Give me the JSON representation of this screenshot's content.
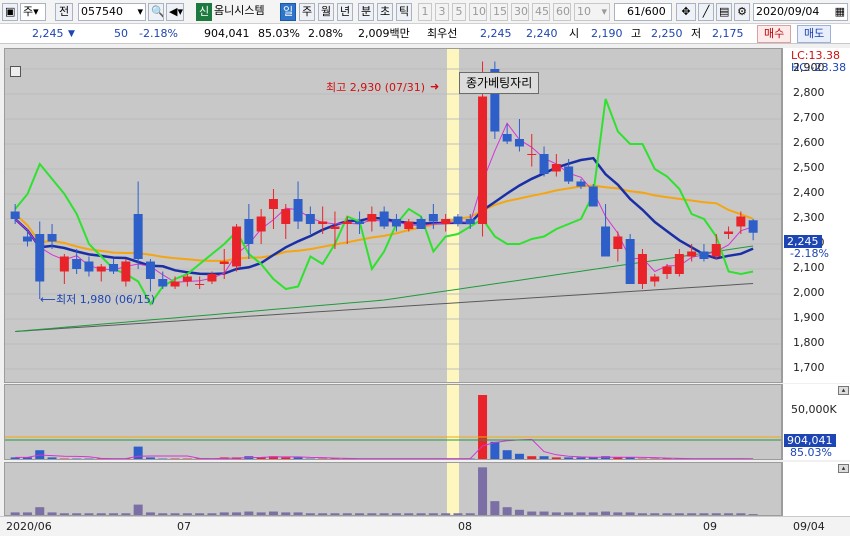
{
  "toolbar": {
    "market_select": "주",
    "prev_btn": "전",
    "code": "057540",
    "speaker_icon": "speaker-icon",
    "sin_badge": "신",
    "company": "옴니시스템",
    "periods": [
      "일",
      "주",
      "월",
      "년",
      "분",
      "초",
      "틱"
    ],
    "active_period": "일",
    "intervals": [
      "1",
      "3",
      "5",
      "10",
      "15",
      "30",
      "45",
      "60"
    ],
    "interval_value": "10",
    "count_value": "61",
    "count_total": "/600",
    "date": "2020/09/04"
  },
  "quote": {
    "price": "2,245",
    "change_arrow": "▼",
    "change": "50",
    "change_pct": "-2.18%",
    "volume": "904,041",
    "vol_ratio": "85.03%",
    "turnover_pct": "2.08%",
    "amount": "2,009백만",
    "best_offer_label": "최우선",
    "best_ask": "2,245",
    "best_bid": "2,240",
    "open_label": "시",
    "open": "2,190",
    "high_label": "고",
    "high": "2,250",
    "low_label": "저",
    "low": "2,175",
    "buy_btn": "매수",
    "sell_btn": "매도"
  },
  "price_axis": {
    "lc": "LC:13.38",
    "hc": "HC:-23.38",
    "ticks": [
      "2,900",
      "2,800",
      "2,700",
      "2,600",
      "2,500",
      "2,400",
      "2,300",
      "2,200",
      "2,100",
      "2,000",
      "1,900",
      "1,800",
      "1,700"
    ],
    "last_price": "2,245",
    "last_pct": "-2.18%"
  },
  "volume_axis": {
    "tick": "50,000K",
    "last_volume": "904,041",
    "last_pct": "85.03%"
  },
  "annotations": {
    "high": "최고 2,930 (07/31)",
    "low": "최저 1,980 (06/15)",
    "tooltip": "종가베팅자리"
  },
  "x_axis": {
    "labels": [
      "2020/06",
      "07",
      "08",
      "09",
      "09/04"
    ]
  },
  "colors": {
    "up": "#e8232a",
    "down": "#2e5fc8",
    "ma5": "#d633d6",
    "ma20": "#1a2fa5",
    "ma60": "#f4a511",
    "ma120": "#1e9a3e",
    "ma240": "#5a5a5a",
    "signal": "#2fe12f"
  },
  "chart_data": {
    "type": "candlestick",
    "ylim": [
      1640,
      2980
    ],
    "candles": [
      [
        2330,
        2360,
        2280,
        2300
      ],
      [
        2230,
        2260,
        2190,
        2210
      ],
      [
        2240,
        2290,
        1980,
        2050
      ],
      [
        2240,
        2280,
        2180,
        2210
      ],
      [
        2090,
        2160,
        2040,
        2150
      ],
      [
        2140,
        2180,
        2080,
        2100
      ],
      [
        2130,
        2150,
        2070,
        2090
      ],
      [
        2090,
        2120,
        2050,
        2110
      ],
      [
        2120,
        2140,
        2080,
        2090
      ],
      [
        2050,
        2140,
        2030,
        2130
      ],
      [
        2320,
        2450,
        2100,
        2140
      ],
      [
        2130,
        2140,
        2010,
        2060
      ],
      [
        2060,
        2090,
        2020,
        2030
      ],
      [
        2030,
        2070,
        2020,
        2050
      ],
      [
        2050,
        2080,
        2030,
        2070
      ],
      [
        2040,
        2070,
        2020,
        2040
      ],
      [
        2050,
        2090,
        2040,
        2080
      ],
      [
        2120,
        2180,
        2060,
        2130
      ],
      [
        2110,
        2280,
        2090,
        2270
      ],
      [
        2300,
        2360,
        2140,
        2200
      ],
      [
        2250,
        2340,
        2200,
        2310
      ],
      [
        2340,
        2420,
        2260,
        2380
      ],
      [
        2280,
        2360,
        2220,
        2340
      ],
      [
        2380,
        2450,
        2260,
        2290
      ],
      [
        2320,
        2350,
        2240,
        2280
      ],
      [
        2280,
        2350,
        2240,
        2290
      ],
      [
        2260,
        2330,
        2180,
        2270
      ],
      [
        2280,
        2310,
        2200,
        2290
      ],
      [
        2290,
        2330,
        2240,
        2280
      ],
      [
        2290,
        2350,
        2250,
        2320
      ],
      [
        2330,
        2350,
        2260,
        2270
      ],
      [
        2300,
        2320,
        2250,
        2270
      ],
      [
        2260,
        2300,
        2250,
        2290
      ],
      [
        2300,
        2310,
        2280,
        2260
      ],
      [
        2320,
        2360,
        2260,
        2290
      ],
      [
        2280,
        2320,
        2250,
        2300
      ],
      [
        2310,
        2320,
        2270,
        2280
      ],
      [
        2300,
        2320,
        2260,
        2280
      ],
      [
        2280,
        2930,
        2230,
        2790
      ],
      [
        2900,
        2930,
        2620,
        2650
      ],
      [
        2640,
        2680,
        2600,
        2610
      ],
      [
        2620,
        2700,
        2570,
        2590
      ],
      [
        2560,
        2640,
        2510,
        2560
      ],
      [
        2560,
        2590,
        2470,
        2480
      ],
      [
        2490,
        2560,
        2470,
        2520
      ],
      [
        2510,
        2540,
        2440,
        2450
      ],
      [
        2450,
        2460,
        2420,
        2430
      ],
      [
        2430,
        2440,
        2350,
        2350
      ],
      [
        2270,
        2360,
        2150,
        2150
      ],
      [
        2180,
        2250,
        2130,
        2230
      ],
      [
        2220,
        2240,
        2040,
        2040
      ],
      [
        2040,
        2180,
        2020,
        2160
      ],
      [
        2050,
        2080,
        2030,
        2070
      ],
      [
        2080,
        2120,
        2060,
        2110
      ],
      [
        2080,
        2180,
        2070,
        2160
      ],
      [
        2150,
        2200,
        2130,
        2170
      ],
      [
        2170,
        2200,
        2130,
        2140
      ],
      [
        2150,
        2240,
        2140,
        2200
      ],
      [
        2240,
        2270,
        2220,
        2250
      ],
      [
        2270,
        2330,
        2240,
        2310
      ],
      [
        2295,
        2300,
        2215,
        2245
      ]
    ],
    "volume": [
      3,
      3,
      9,
      3,
      2,
      2,
      2,
      2,
      2,
      2,
      12,
      3,
      2,
      2,
      2,
      2,
      2,
      3,
      3,
      4,
      3,
      4,
      3,
      3,
      2,
      2,
      2,
      2,
      2,
      2,
      2,
      2,
      2,
      2,
      2,
      2,
      2,
      2,
      55,
      16,
      9,
      6,
      4,
      4,
      3,
      3,
      3,
      3,
      4,
      3,
      3,
      2,
      2,
      2,
      2,
      2,
      2,
      2,
      2,
      2,
      1
    ],
    "series": [
      {
        "name": "MA5"
      },
      {
        "name": "MA20"
      },
      {
        "name": "MA60"
      },
      {
        "name": "MA120"
      },
      {
        "name": "MA240"
      },
      {
        "name": "Signal"
      }
    ]
  }
}
